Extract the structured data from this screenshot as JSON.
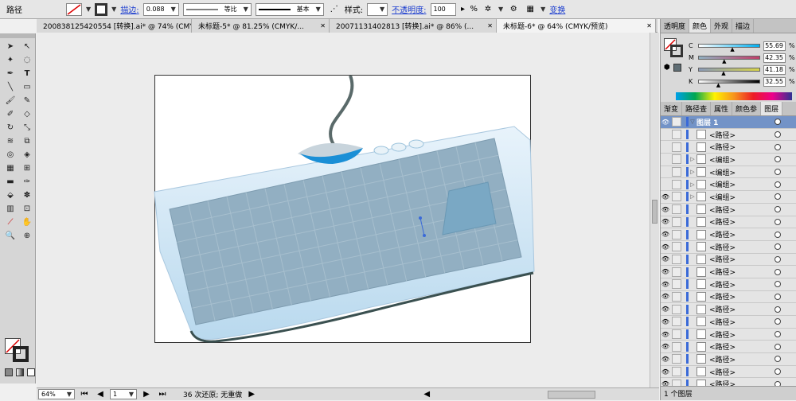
{
  "control": {
    "object_type": "路径",
    "stroke_label": "描边:",
    "stroke_weight": "0.088",
    "profile_label": "等比",
    "brush_label": "基本",
    "style_label": "样式:",
    "opacity_label": "不透明度:",
    "opacity_value": "100",
    "opacity_unit": "%",
    "transform_label": "变换"
  },
  "tabs": [
    {
      "label": "200838125420554 [转换].ai* @ 74% (CMY...",
      "active": false
    },
    {
      "label": "未标题-5* @ 81.25% (CMYK/...",
      "active": false
    },
    {
      "label": "20071131402813 [转换].ai* @ 86% (...",
      "active": false
    },
    {
      "label": "未标题-6* @ 64% (CMYK/预览)",
      "active": true
    }
  ],
  "panel_color": {
    "tabs": [
      "透明度",
      "颜色",
      "外观",
      "描边"
    ],
    "active_tab": "颜色",
    "channels": [
      {
        "label": "C",
        "value": "55.69",
        "level": 55.69,
        "grad": "linear-gradient(90deg,#fff,#00aeef)"
      },
      {
        "label": "M",
        "value": "42.35",
        "level": 42.35,
        "grad": "linear-gradient(90deg,#8fb0c0,#c0406a)"
      },
      {
        "label": "Y",
        "value": "41.18",
        "level": 41.18,
        "grad": "linear-gradient(90deg,#8a9ab8,#d8d44a)"
      },
      {
        "label": "K",
        "value": "32.55",
        "level": 32.55,
        "grad": "linear-gradient(90deg,#fff,#000)"
      }
    ],
    "pct": "%"
  },
  "panel_layers": {
    "tabs": [
      "渐变",
      "路径查",
      "属性",
      "颜色参",
      "图层"
    ],
    "active_tab": "图层",
    "rows": [
      {
        "name": "图层 1",
        "head": true,
        "tri": "▽"
      },
      {
        "name": "<路径>",
        "tri": ""
      },
      {
        "name": "<路径>",
        "tri": ""
      },
      {
        "name": "<编组>",
        "tri": "▷"
      },
      {
        "name": "<编组>",
        "tri": "▷"
      },
      {
        "name": "<编组>",
        "tri": "▷"
      },
      {
        "name": "<编组>",
        "tri": "▷"
      },
      {
        "name": "<路径>",
        "tri": ""
      },
      {
        "name": "<路径>",
        "tri": ""
      },
      {
        "name": "<路径>",
        "tri": ""
      },
      {
        "name": "<路径>",
        "tri": ""
      },
      {
        "name": "<路径>",
        "tri": ""
      },
      {
        "name": "<路径>",
        "tri": ""
      },
      {
        "name": "<路径>",
        "tri": ""
      },
      {
        "name": "<路径>",
        "tri": ""
      },
      {
        "name": "<路径>",
        "tri": ""
      },
      {
        "name": "<路径>",
        "tri": ""
      },
      {
        "name": "<路径>",
        "tri": ""
      },
      {
        "name": "<路径>",
        "tri": ""
      },
      {
        "name": "<路径>",
        "tri": ""
      },
      {
        "name": "<路径>",
        "tri": ""
      },
      {
        "name": "<路径>",
        "tri": ""
      }
    ],
    "footer": "1 个图层"
  },
  "status": {
    "zoom": "64%",
    "page": "1",
    "info": "36 次还原; 无重做"
  }
}
